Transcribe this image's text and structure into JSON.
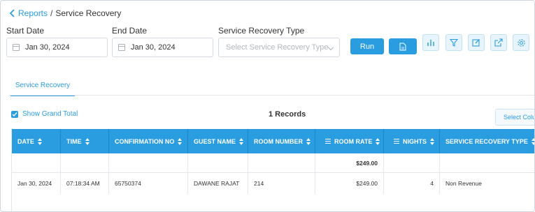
{
  "breadcrumb": {
    "parent": "Reports",
    "separator": "/",
    "current": "Service Recovery"
  },
  "filters": {
    "start_date_label": "Start Date",
    "start_date_value": "Jan 30, 2024",
    "end_date_label": "End Date",
    "end_date_value": "Jan 30, 2024",
    "type_label": "Service Recovery Type",
    "type_placeholder": "Select Service Recovery Type"
  },
  "toolbar": {
    "run_label": "Run",
    "icons": [
      "file-pdf-icon",
      "bar-chart-icon",
      "filter-icon",
      "edit-icon",
      "external-link-icon",
      "settings-icon"
    ]
  },
  "tabs": [
    {
      "label": "Service Recovery"
    }
  ],
  "options": {
    "show_grand_total_label": "Show Grand Total",
    "show_grand_total_checked": true,
    "records_text": "1 Records",
    "select_columns_label": "Select Colu"
  },
  "table": {
    "columns": [
      {
        "label": "DATE"
      },
      {
        "label": "TIME"
      },
      {
        "label": "CONFIRMATION NO"
      },
      {
        "label": "GUEST NAME"
      },
      {
        "label": "ROOM NUMBER"
      },
      {
        "label": "ROOM RATE"
      },
      {
        "label": "NIGHTS"
      },
      {
        "label": "SERVICE RECOVERY TYPE"
      }
    ],
    "totals": {
      "room_rate": "$249.00"
    },
    "rows": [
      {
        "date": "Jan 30, 2024",
        "time": "07:18:34 AM",
        "confirmation_no": "65750374",
        "guest_name": "DAWANE RAJAT",
        "room_number": "214",
        "room_rate": "$249.00",
        "nights": "4",
        "service_recovery_type": "Non Revenue"
      }
    ]
  },
  "colors": {
    "accent": "#2a9ce0",
    "header_text": "#ffffff",
    "border": "#e3e7eb"
  }
}
